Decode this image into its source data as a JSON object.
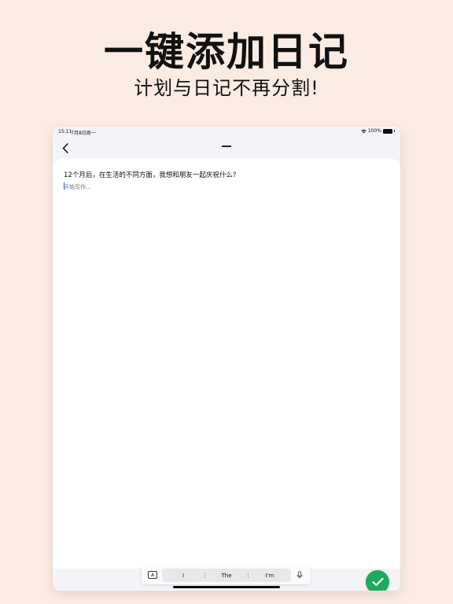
{
  "promo": {
    "title": "一键添加日记",
    "subtitle": "计划与日记不再分割!"
  },
  "status_bar": {
    "time": "15:11",
    "date": "7月8日周一",
    "battery": "100%"
  },
  "editor": {
    "prompt": "12个月后，在生活的不同方面，我想和朋友一起庆祝什么?",
    "placeholder": "开始写作..."
  },
  "keyboard": {
    "format_label": "A",
    "suggestions": [
      "I",
      "The",
      "I'm"
    ]
  },
  "colors": {
    "background": "#fbece3",
    "accent_green": "#1daa5f",
    "sheet": "#ffffff",
    "chrome": "#f4f4f8"
  },
  "icons": {
    "back": "chevron-left-icon",
    "done": "checkmark-icon",
    "mic": "microphone-icon",
    "wifi": "wifi-icon",
    "battery": "battery-icon"
  }
}
